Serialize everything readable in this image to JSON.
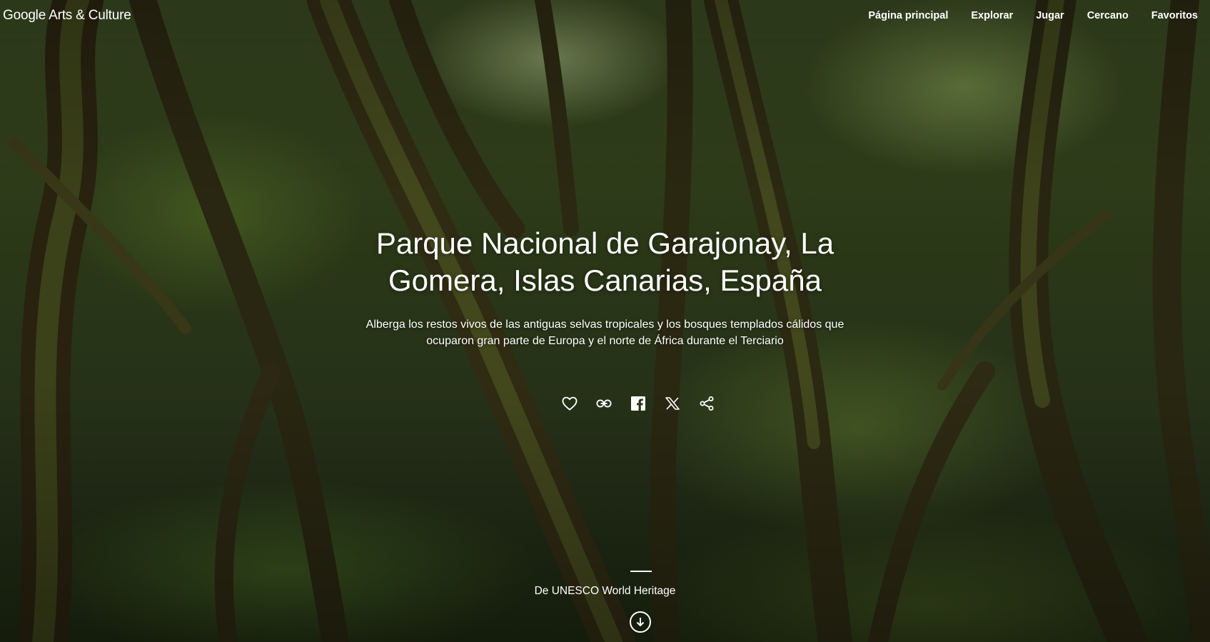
{
  "header": {
    "logo_google": "Google",
    "logo_rest": "Arts & Culture",
    "nav": [
      {
        "label": "Página principal"
      },
      {
        "label": "Explorar"
      },
      {
        "label": "Jugar"
      },
      {
        "label": "Cercano"
      },
      {
        "label": "Favoritos"
      }
    ]
  },
  "hero": {
    "title": "Parque Nacional de Garajonay, La Gomera, Islas Canarias, España",
    "description": "Alberga los restos vivos de las antiguas selvas tropicales y los bosques templados cálidos que ocuparon gran parte de Europa y el norte de África durante el Terciario",
    "source": "De UNESCO World Heritage"
  },
  "actions": [
    {
      "icon": "heart-icon"
    },
    {
      "icon": "link-icon"
    },
    {
      "icon": "facebook-icon"
    },
    {
      "icon": "x-icon"
    },
    {
      "icon": "share-icon"
    }
  ],
  "colors": {
    "text": "#ffffff",
    "forest_dark": "#1f2a12",
    "forest_light": "#3a4a22"
  }
}
